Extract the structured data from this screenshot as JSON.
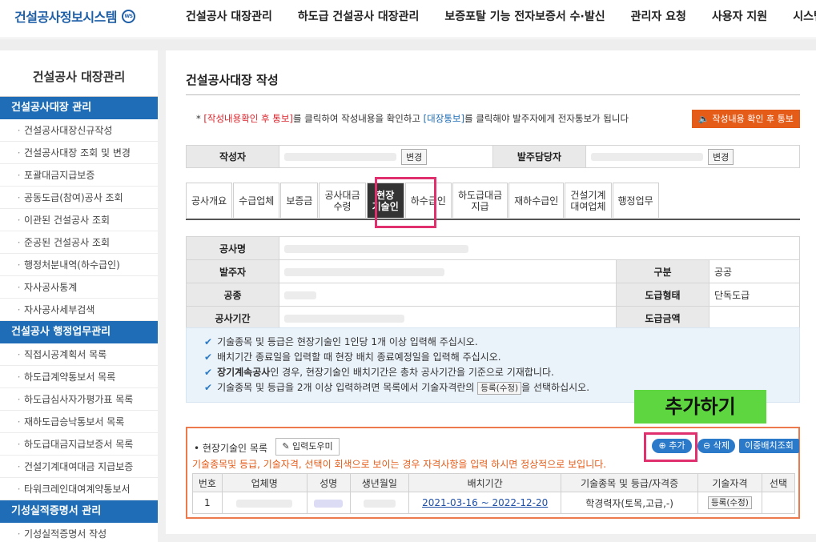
{
  "header": {
    "logo": "건설공사정보시스템",
    "logo_badge": "WS",
    "nav": [
      "건설공사 대장관리",
      "하도급 건설공사 대장관리",
      "보증포탈 기능 전자보증서 수·발신",
      "관리자 요청",
      "사용자 지원",
      "시스템 안내"
    ]
  },
  "sidebar": {
    "title": "건설공사 대장관리",
    "sections": [
      {
        "label": "건설공사대장 관리",
        "items": [
          "건설공사대장신규작성",
          "건설공사대장 조회 및 변경",
          "포괄대금지급보증",
          "공동도급(참여)공사 조회",
          "이관된 건설공사 조회",
          "준공된 건설공사 조회",
          "행정처분내역(하수급인)",
          "자사공사통계",
          "자사공사세부검색"
        ]
      },
      {
        "label": "건설공사 행정업무관리",
        "items": [
          "직접시공계획서 목록",
          "하도급계약통보서 목록",
          "하도급심사자가평가표 목록",
          "재하도급승낙통보서 목록",
          "하도급대금지급보증서 목록",
          "건설기계대여대금 지급보증",
          "타워크레인대여계약통보서"
        ]
      },
      {
        "label": "기성실적증명서 관리",
        "items": [
          "기성실적증명서 작성"
        ]
      }
    ]
  },
  "main": {
    "title": "건설공사대장 작성",
    "notice": {
      "star": "*",
      "link1": "[작성내용확인 후 통보]",
      "mid": "를 클릭하여 작성내용을 확인하고",
      "link2": "[대장통보]",
      "end": "를 클릭해야 발주자에게 전자통보가 됩니다"
    },
    "notify_button": "작성내용 확인 후 통보",
    "info": {
      "writer_label": "작성자",
      "owner_label": "발주담당자",
      "change_label": "변경"
    },
    "tabs": [
      {
        "label": "공사개요",
        "active": false
      },
      {
        "label": "수급업체",
        "active": false
      },
      {
        "label": "보증금",
        "active": false
      },
      {
        "label": "공사대금\n수령",
        "active": false
      },
      {
        "label": "현장\n기술인",
        "active": true
      },
      {
        "label": "하수급인",
        "active": false
      },
      {
        "label": "하도급대금\n지급",
        "active": false
      },
      {
        "label": "재하수급인",
        "active": false
      },
      {
        "label": "건설기계\n대여업체",
        "active": false
      },
      {
        "label": "행정업무",
        "active": false
      }
    ],
    "project": {
      "name_label": "공사명",
      "client_label": "발주자",
      "type_label": "구분",
      "type_value": "공공",
      "work_label": "공종",
      "contract_label": "도급형태",
      "contract_value": "단독도급",
      "period_label": "공사기간",
      "amount_label": "도급금액"
    },
    "guide": {
      "line1": "기술종목 및 등급은 현장기술인 1인당 1개 이상 입력해 주십시오.",
      "line2": "배치기간 종료일을 입력할 때 현장 배치 종료예정일을 입력해 주십시오.",
      "line3_bold": "장기계속공사",
      "line3_rest": "인 경우, 현장기술인 배치기간은 총차 공사기간을 기준으로 기재합니다.",
      "line4_pre": "기술종목 및 등급을 2개 이상 입력하려면 목록에서 기술자격란의",
      "line4_btn": "등록(수정)",
      "line4_post": "을 선택하십시오."
    },
    "overlay_label": "추가하기",
    "list": {
      "title": "• 현장기술인 목록",
      "helper": "입력도우미",
      "warning": "기술종목및 등급, 기술자격, 선택이 회색으로 보이는 경우 자격사항을 입력 하시면 정상적으로 보입니다.",
      "add": "추가",
      "delete": "삭제",
      "move": "이중배치조회",
      "headers": [
        "번호",
        "업체명",
        "성명",
        "생년월일",
        "배치기간",
        "기술종목 및 등급/자격증",
        "기술자격",
        "선택"
      ],
      "rows": [
        {
          "no": "1",
          "period": "2021-03-16 ~ 2022-12-20",
          "grade": "학경력자(토목,고급,-)",
          "cert": "등록(수정)"
        }
      ]
    }
  }
}
